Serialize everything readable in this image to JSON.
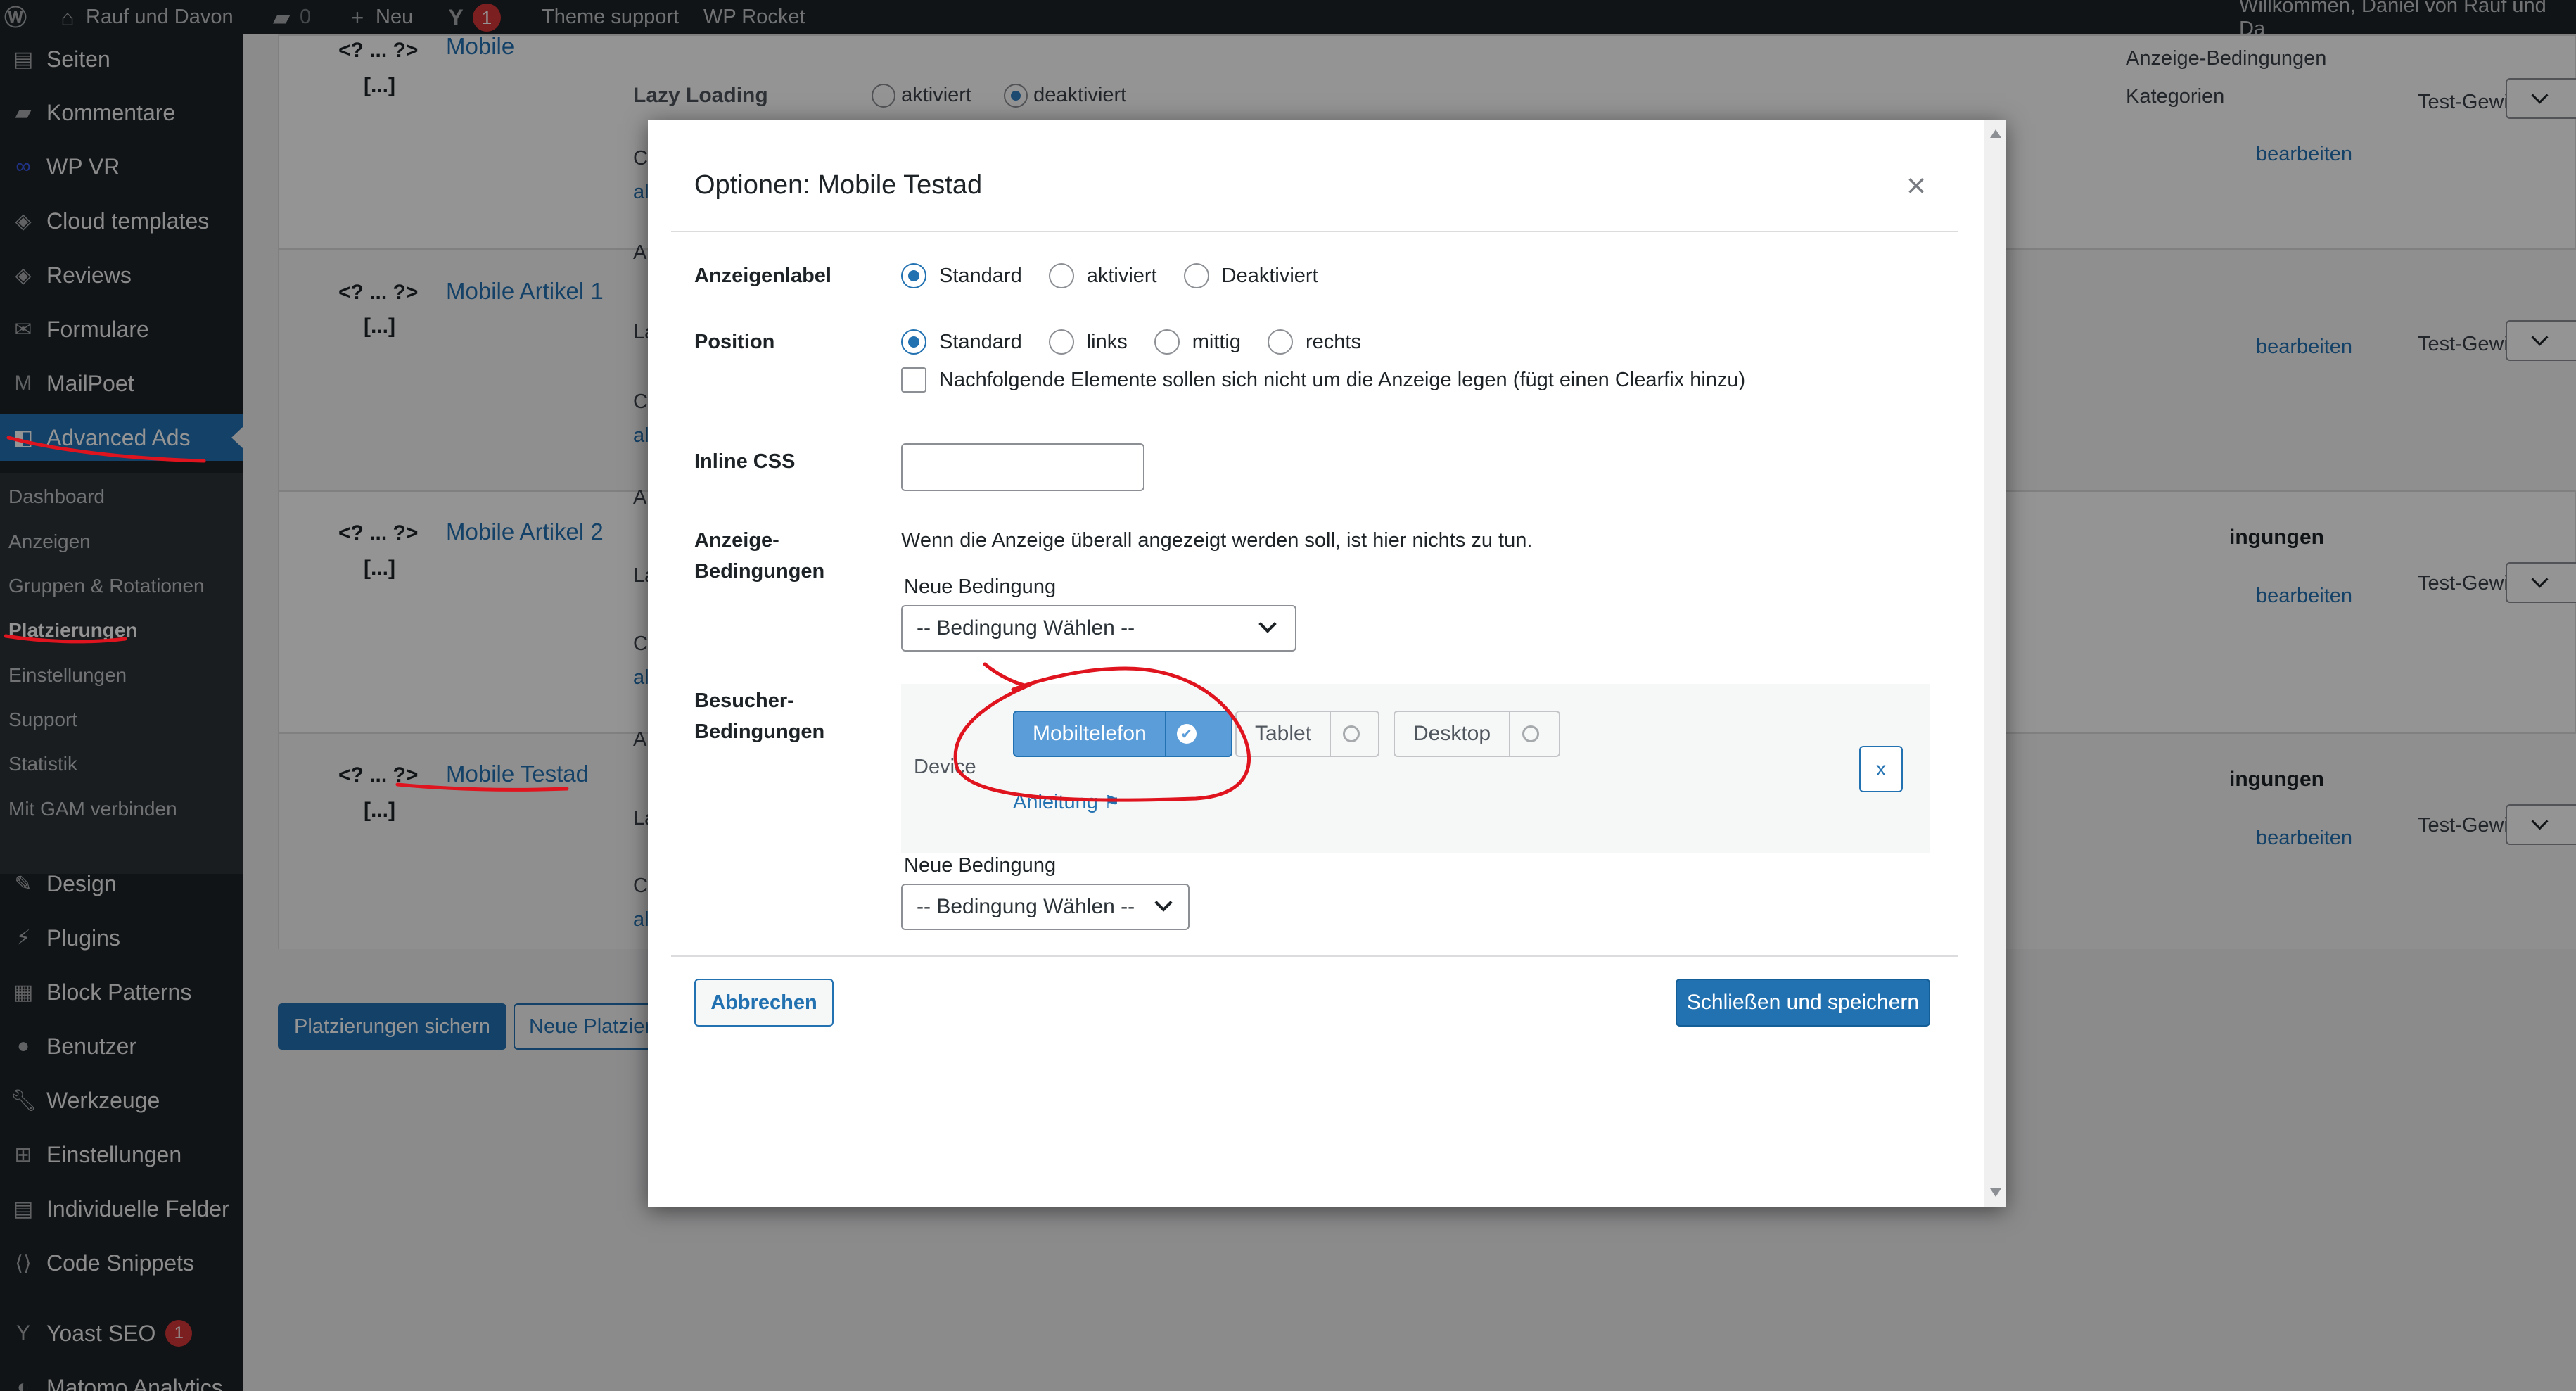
{
  "adminbar": {
    "site_name": "Rauf und Davon",
    "comments_count": "0",
    "new_label": "Neu",
    "updates_count": "1",
    "theme_support": "Theme support",
    "wp_rocket": "WP Rocket",
    "welcome": "Willkommen, Daniel von Rauf und Da"
  },
  "sidebar": {
    "items": [
      {
        "label": "Seiten",
        "icon": "pages-icon"
      },
      {
        "label": "Kommentare",
        "icon": "comments-icon"
      },
      {
        "label": "WP VR",
        "icon": "vr-icon"
      },
      {
        "label": "Cloud templates",
        "icon": "cloud-icon"
      },
      {
        "label": "Reviews",
        "icon": "reviews-icon"
      },
      {
        "label": "Formulare",
        "icon": "form-icon"
      },
      {
        "label": "MailPoet",
        "icon": "mailpoet-icon"
      },
      {
        "label": "Advanced Ads",
        "icon": "advanced-ads-icon"
      }
    ],
    "submenu": [
      "Dashboard",
      "Anzeigen",
      "Gruppen & Rotationen",
      "Platzierungen",
      "Einstellungen",
      "Support",
      "Statistik",
      "Mit GAM verbinden"
    ],
    "items_after": [
      {
        "label": "Design",
        "icon": "design-icon"
      },
      {
        "label": "Plugins",
        "icon": "plugins-icon"
      },
      {
        "label": "Block Patterns",
        "icon": "block-patterns-icon"
      },
      {
        "label": "Benutzer",
        "icon": "users-icon"
      },
      {
        "label": "Werkzeuge",
        "icon": "tools-icon"
      },
      {
        "label": "Einstellungen",
        "icon": "settings-icon"
      },
      {
        "label": "Individuelle Felder",
        "icon": "custom-fields-icon"
      },
      {
        "label": "Code Snippets",
        "icon": "code-snippets-icon"
      },
      {
        "label": "Yoast SEO",
        "icon": "yoast-icon"
      },
      {
        "label": "Matomo Analytics",
        "icon": "matomo-icon"
      }
    ],
    "yoast_badge": "1"
  },
  "background": {
    "code": "<? ... ?>",
    "code_more": "[...]",
    "rows": [
      {
        "name": "Mobile"
      },
      {
        "name": "Mobile Artikel 1"
      },
      {
        "name": "Mobile Artikel 2"
      },
      {
        "name": "Mobile Testad"
      }
    ],
    "lazy_loading_label": "Lazy Loading",
    "lazy_on": "aktiviert",
    "lazy_off": "deaktiviert",
    "right_heading_1": "Anzeige-Bedingungen",
    "right_heading_2": "Kategorien",
    "right_partial": "ingungen",
    "edit_link": "bearbeiten",
    "weight_label": "Test-Gewicht",
    "fragment_a": "A",
    "fragment_l": "La",
    "fragment_c": "C",
    "fragment_al": "al",
    "save_placements": "Platzierungen sichern",
    "new_placement": "Neue Platzierung"
  },
  "modal": {
    "title": "Optionen: Mobile Testad",
    "close": "×",
    "ad_label": {
      "label": "Anzeigenlabel",
      "options": [
        "Standard",
        "aktiviert",
        "Deaktiviert"
      ],
      "selected": "Standard"
    },
    "position": {
      "label": "Position",
      "options": [
        "Standard",
        "links",
        "mittig",
        "rechts"
      ],
      "selected": "Standard",
      "clearfix": "Nachfolgende Elemente sollen sich nicht um die Anzeige legen (fügt einen Clearfix hinzu)"
    },
    "inline_css": {
      "label": "Inline CSS",
      "value": ""
    },
    "display_conditions": {
      "label_line1": "Anzeige-",
      "label_line2": "Bedingungen",
      "info": "Wenn die Anzeige überall angezeigt werden soll, ist hier nichts zu tun.",
      "new_condition_label": "Neue Bedingung",
      "select_placeholder": "-- Bedingung Wählen --"
    },
    "visitor_conditions": {
      "label_line1": "Besucher-",
      "label_line2": "Bedingungen",
      "device_label": "Device",
      "devices": [
        {
          "label": "Mobiltelefon",
          "selected": true
        },
        {
          "label": "Tablet",
          "selected": false
        },
        {
          "label": "Desktop",
          "selected": false
        }
      ],
      "remove_label": "x",
      "manual_link": "Anleitung",
      "new_condition_label": "Neue Bedingung",
      "select_placeholder": "-- Bedingung Wählen --"
    },
    "cancel_label": "Abbrechen",
    "save_label": "Schließen und speichern"
  },
  "colors": {
    "admin_bar": "#1d2327",
    "accent": "#2271b1",
    "selected_device": "#5b9dd9",
    "annotation": "#e0141e"
  }
}
